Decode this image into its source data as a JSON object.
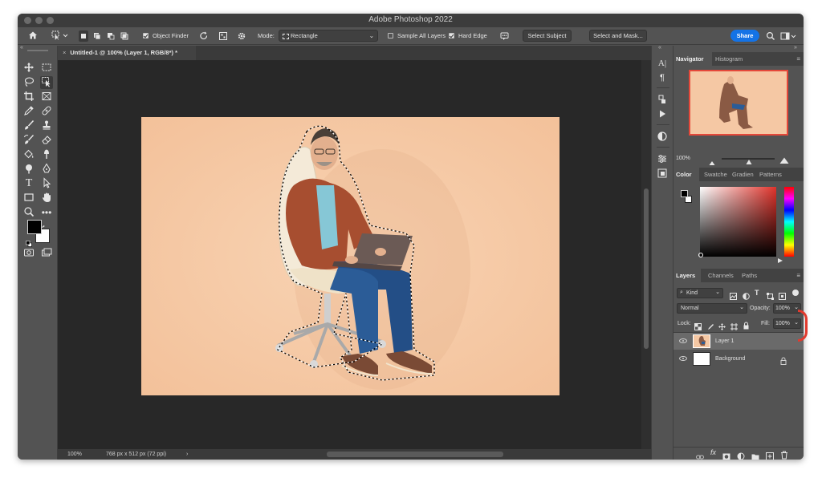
{
  "window": {
    "title": "Adobe Photoshop 2022"
  },
  "options_bar": {
    "object_finder_label": "Object Finder",
    "mode_label": "Mode:",
    "mode_value": "Rectangle",
    "sample_all_layers_label": "Sample All Layers",
    "sample_all_layers_checked": false,
    "hard_edge_label": "Hard Edge",
    "hard_edge_checked": true,
    "select_subject_label": "Select Subject",
    "select_and_mask_label": "Select and Mask...",
    "share_label": "Share",
    "colors": {
      "share": "#1473e6"
    }
  },
  "document": {
    "tab_close": "×",
    "tab_title": "Untitled-1 @ 100% (Layer 1, RGB/8*) *",
    "zoom": "100%",
    "doc_info": "768 px x 512 px (72 ppi)",
    "status_arrow": "›",
    "canvas_bg": "#f5c8a4"
  },
  "toolbar": {
    "foreground_color": "#000000",
    "background_color": "#ffffff"
  },
  "navigator": {
    "tabs": [
      "Navigator",
      "Histogram"
    ],
    "zoom": "100%"
  },
  "color_panel": {
    "tabs": [
      "Color",
      "Swatche",
      "Gradien",
      "Patterns"
    ]
  },
  "layers_panel": {
    "tabs": [
      "Layers",
      "Channels",
      "Paths"
    ],
    "filter_kind": "Kind",
    "blend_mode": "Normal",
    "opacity_label": "Opacity:",
    "opacity_value": "100%",
    "lock_label": "Lock:",
    "fill_label": "Fill:",
    "fill_value": "100%",
    "layers": [
      {
        "name": "Layer 1",
        "selected": true
      },
      {
        "name": "Background",
        "locked": true
      }
    ]
  }
}
